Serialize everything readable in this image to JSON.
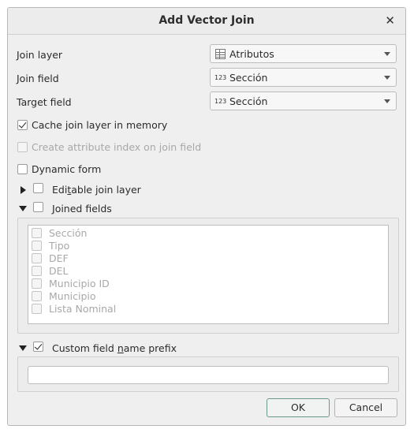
{
  "dialog": {
    "title": "Add Vector Join",
    "close_icon": "close-icon"
  },
  "form": {
    "join_layer": {
      "label": "Join layer",
      "value": "Atributos",
      "icon": "table-icon"
    },
    "join_field": {
      "label": "Join field",
      "value": "Sección",
      "type_badge": "123"
    },
    "target_field": {
      "label": "Target field",
      "value": "Sección",
      "type_badge": "123"
    }
  },
  "options": {
    "cache": {
      "label": "Cache join layer in memory",
      "checked": true
    },
    "attr_index": {
      "label": "Create attribute index on join field",
      "checked": false,
      "enabled": false
    },
    "dynamic_form": {
      "label": "Dynamic form",
      "checked": false
    }
  },
  "editable": {
    "label_pre": "Edi",
    "label_mnemonic": "t",
    "label_post": "able join layer",
    "expanded": false,
    "checked": false
  },
  "joined_fields": {
    "label_mnemonic": "J",
    "label_post": "oined fields",
    "expanded": true,
    "checked": false,
    "items": [
      "Sección",
      "Tipo",
      "DEF",
      "DEL",
      "Municipio ID",
      "Municipio",
      "Lista Nominal"
    ]
  },
  "prefix": {
    "label_pre": "Custom field ",
    "label_mnemonic": "n",
    "label_post": "ame prefix",
    "expanded": true,
    "checked": true,
    "value": ""
  },
  "buttons": {
    "ok": "OK",
    "cancel": "Cancel"
  }
}
